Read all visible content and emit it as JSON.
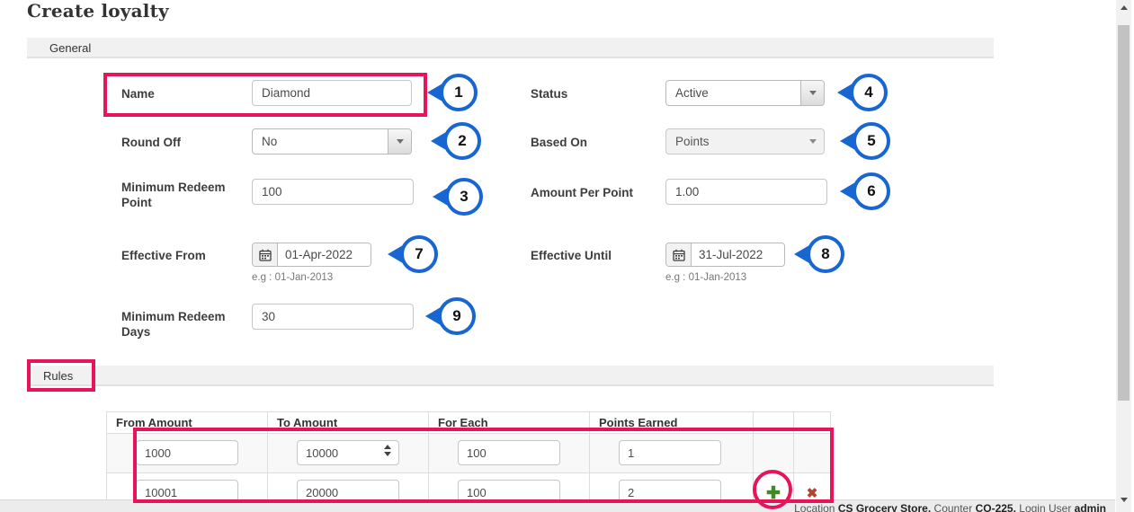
{
  "page": {
    "title": "Create loyalty"
  },
  "tabs": {
    "general": "General",
    "rules": "Rules"
  },
  "form": {
    "name": {
      "label": "Name",
      "value": "Diamond"
    },
    "status": {
      "label": "Status",
      "value": "Active"
    },
    "round_off": {
      "label": "Round Off",
      "value": "No"
    },
    "based_on": {
      "label": "Based On",
      "value": "Points"
    },
    "minimum_redeem_point": {
      "label": "Minimum Redeem Point",
      "value": "100"
    },
    "amount_per_point": {
      "label": "Amount Per Point",
      "value": "1.00"
    },
    "effective_from": {
      "label": "Effective From",
      "value": "01-Apr-2022",
      "hint": "e.g : 01-Jan-2013"
    },
    "effective_until": {
      "label": "Effective Until",
      "value": "31-Jul-2022",
      "hint": "e.g : 01-Jan-2013"
    },
    "minimum_redeem_days": {
      "label": "Minimum Redeem Days",
      "value": "30"
    }
  },
  "callouts": [
    "1",
    "2",
    "3",
    "4",
    "5",
    "6",
    "7",
    "8",
    "9"
  ],
  "rules_table": {
    "headers": [
      "From Amount",
      "To Amount",
      "For Each",
      "Points Earned"
    ],
    "rows": [
      {
        "from": "1000",
        "to": "10000",
        "each": "100",
        "points": "1"
      },
      {
        "from": "10001",
        "to": "20000",
        "each": "100",
        "points": "2"
      }
    ],
    "add_icon": "✚",
    "remove_icon": "✖"
  },
  "footer": {
    "location_label": "Location",
    "location_value": "CS Grocery Store,",
    "counter_label": "Counter",
    "counter_value": "CO-225,",
    "login_label": "Login User",
    "login_value": "admin"
  },
  "colors": {
    "annotation_red": "#e6155a",
    "callout_blue": "#1766d1",
    "add_green": "#3e8a25",
    "remove_red": "#b5432f"
  }
}
